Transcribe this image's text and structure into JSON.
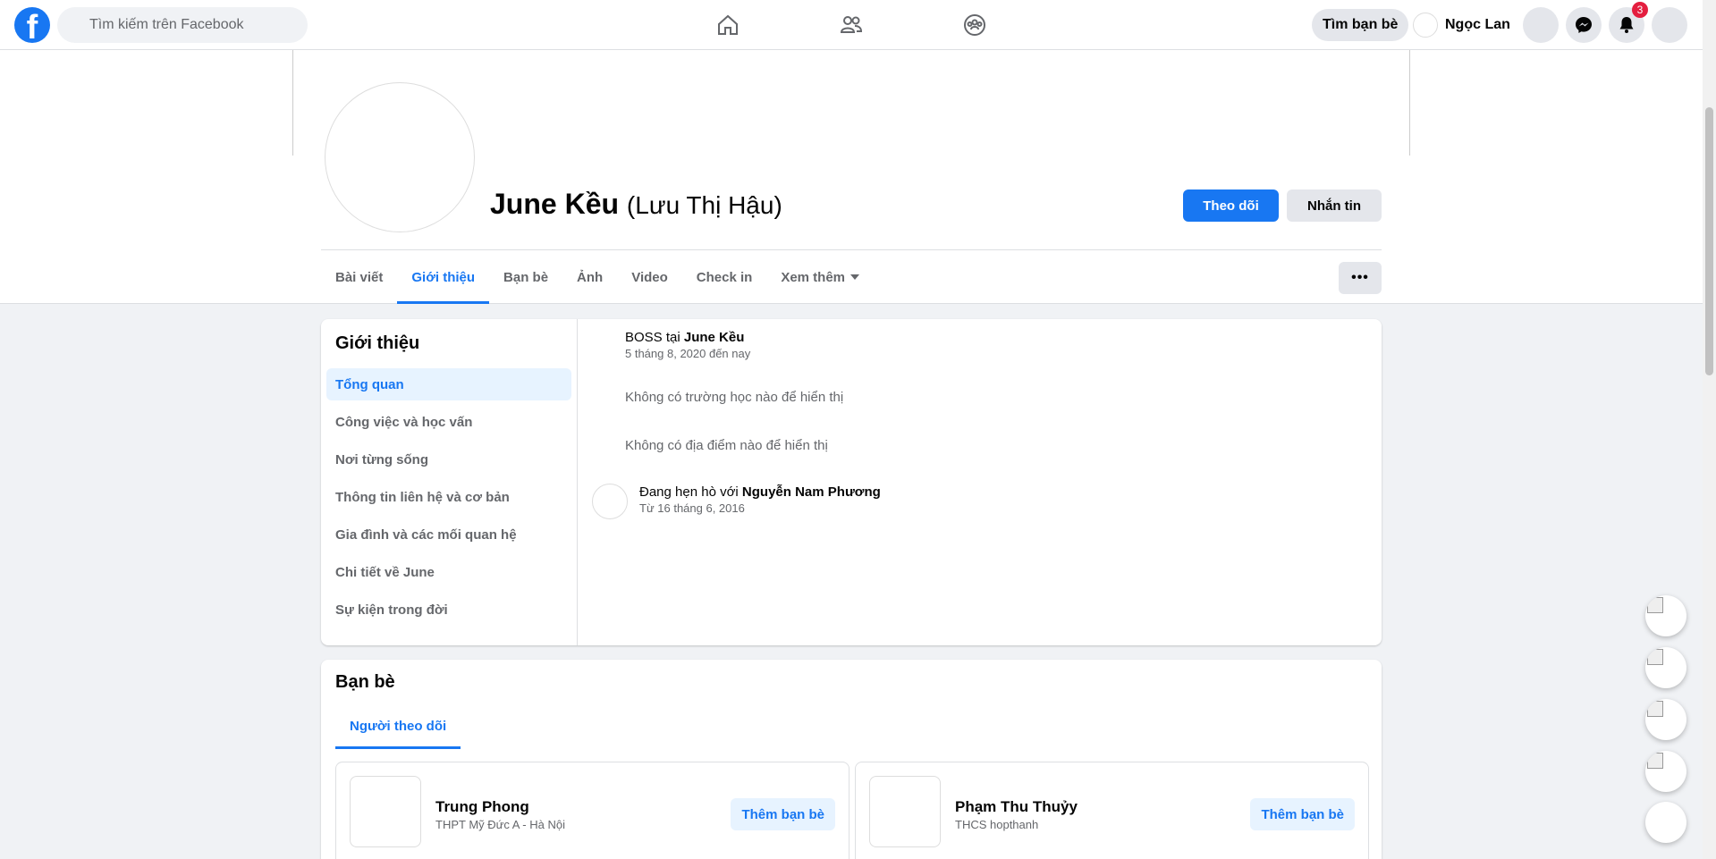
{
  "nav": {
    "search_placeholder": "Tìm kiếm trên Facebook",
    "find_friends": "Tìm bạn bè",
    "user_name": "Ngọc Lan",
    "notification_count": "3"
  },
  "profile": {
    "name": "June Kều",
    "alt_name": "(Lưu Thị Hậu)",
    "follow_label": "Theo dõi",
    "message_label": "Nhắn tin"
  },
  "tabs": [
    "Bài viết",
    "Giới thiệu",
    "Bạn bè",
    "Ảnh",
    "Video",
    "Check in",
    "Xem thêm"
  ],
  "about": {
    "title": "Giới thiệu",
    "menu": [
      "Tổng quan",
      "Công việc và học vấn",
      "Nơi từng sống",
      "Thông tin liên hệ và cơ bản",
      "Gia đình và các mối quan hệ",
      "Chi tiết về June",
      "Sự kiện trong đời"
    ],
    "work_prefix": "BOSS tại",
    "work_place": "June Kều",
    "work_dates": "5 tháng 8, 2020 đến nay",
    "no_school": "Không có trường học nào để hiển thị",
    "no_places": "Không có địa điểm nào để hiển thị",
    "relationship_prefix": "Đang hẹn hò với",
    "relationship_partner": "Nguyễn Nam Phương",
    "relationship_since": "Từ 16 tháng 6, 2016"
  },
  "friends": {
    "title": "Bạn bè",
    "tab": "Người theo dõi",
    "items": [
      {
        "name": "Trung Phong",
        "subtitle": "THPT Mỹ Đức A - Hà Nội",
        "action": "Thêm bạn bè"
      },
      {
        "name": "Phạm Thu Thuỷy",
        "subtitle": "THCS hopthanh",
        "action": "Thêm bạn bè"
      }
    ]
  },
  "colors": {
    "accent": "#1877f2",
    "background": "#f0f2f5",
    "badge": "#e41e3f"
  },
  "icons": [
    "facebook-logo-icon",
    "search-icon",
    "home-icon",
    "friends-icon",
    "groups-icon",
    "messenger-icon",
    "bell-icon",
    "more-dots-icon",
    "caret-down-icon"
  ]
}
